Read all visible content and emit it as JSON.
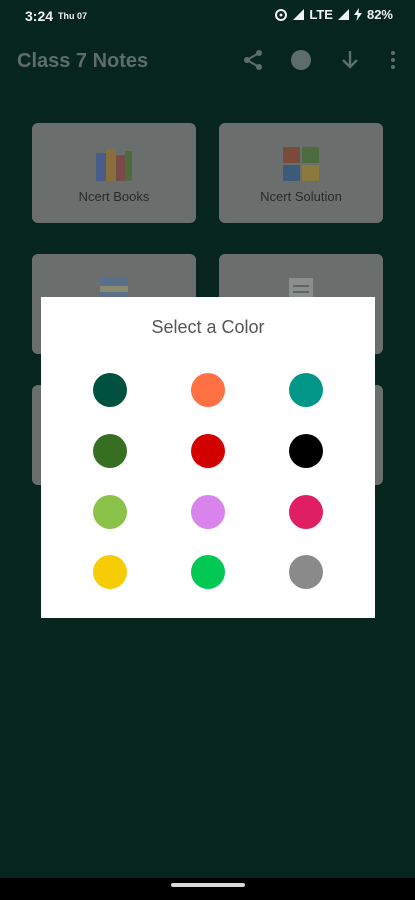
{
  "status_bar": {
    "time": "3:24",
    "day": "Thu 07",
    "network": "LTE",
    "battery": "82%"
  },
  "app_bar": {
    "title": "Class 7 Notes"
  },
  "cards": [
    {
      "label": "Ncert Books",
      "icon": "books-icon"
    },
    {
      "label": "Ncert Solution",
      "icon": "puzzle-icon"
    },
    {
      "label": "",
      "icon": "exemplar-book-icon"
    },
    {
      "label": "",
      "icon": "document-icon"
    },
    {
      "label": "",
      "icon": "card-icon"
    },
    {
      "label": "",
      "icon": "card-icon"
    }
  ],
  "dialog": {
    "title": "Select a Color",
    "colors": [
      "#00513f",
      "#ff7043",
      "#009688",
      "#376f22",
      "#d30000",
      "#000000",
      "#8bc34a",
      "#d884ec",
      "#e01f62",
      "#f5cc05",
      "#00c853",
      "#8a8a8a"
    ]
  }
}
